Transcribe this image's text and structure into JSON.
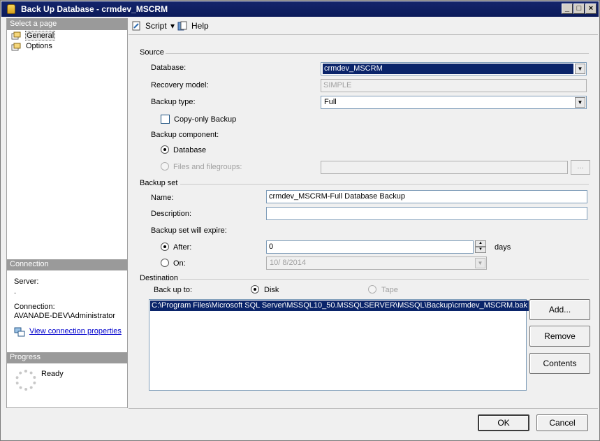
{
  "window": {
    "title": "Back Up Database - crmdev_MSCRM",
    "min_label": "_",
    "max_label": "□",
    "close_label": "×"
  },
  "left": {
    "select_page_header": "Select a page",
    "pages": [
      {
        "label": "General",
        "icon": "page-icon"
      },
      {
        "label": "Options",
        "icon": "page-icon"
      }
    ],
    "connection_header": "Connection",
    "server_label": "Server:",
    "server_value": ".",
    "connection_label": "Connection:",
    "connection_value": "AVANADE-DEV\\Administrator",
    "view_connection_link": "View connection properties",
    "progress_header": "Progress",
    "progress_status": "Ready"
  },
  "toolbar": {
    "script_label": "Script",
    "script_arrow": "▾",
    "help_label": "Help"
  },
  "source": {
    "section_label": "Source",
    "database_label": "Database:",
    "database_value": "crmdev_MSCRM",
    "recovery_label": "Recovery model:",
    "recovery_value": "SIMPLE",
    "backup_type_label": "Backup type:",
    "backup_type_value": "Full",
    "copy_only_label": "Copy-only Backup",
    "component_label": "Backup component:",
    "component_database_label": "Database",
    "component_files_label": "Files and filegroups:",
    "browse_label": "..."
  },
  "backup_set": {
    "section_label": "Backup set",
    "name_label": "Name:",
    "name_value": "crmdev_MSCRM-Full Database Backup",
    "description_label": "Description:",
    "description_value": "",
    "expire_label": "Backup set will expire:",
    "after_label": "After:",
    "after_value": "0",
    "days_label": "days",
    "on_label": "On:",
    "on_value": "10/  8/2014"
  },
  "destination": {
    "section_label": "Destination",
    "back_up_to_label": "Back up to:",
    "disk_label": "Disk",
    "tape_label": "Tape",
    "paths": [
      "C:\\Program Files\\Microsoft SQL Server\\MSSQL10_50.MSSQLSERVER\\MSSQL\\Backup\\crmdev_MSCRM.bak"
    ],
    "add_label": "Add...",
    "remove_label": "Remove",
    "contents_label": "Contents"
  },
  "footer": {
    "ok_label": "OK",
    "cancel_label": "Cancel"
  },
  "colors": {
    "titlebar": "#0b1a5a",
    "selection": "#0a246a",
    "link": "#0000cc"
  }
}
